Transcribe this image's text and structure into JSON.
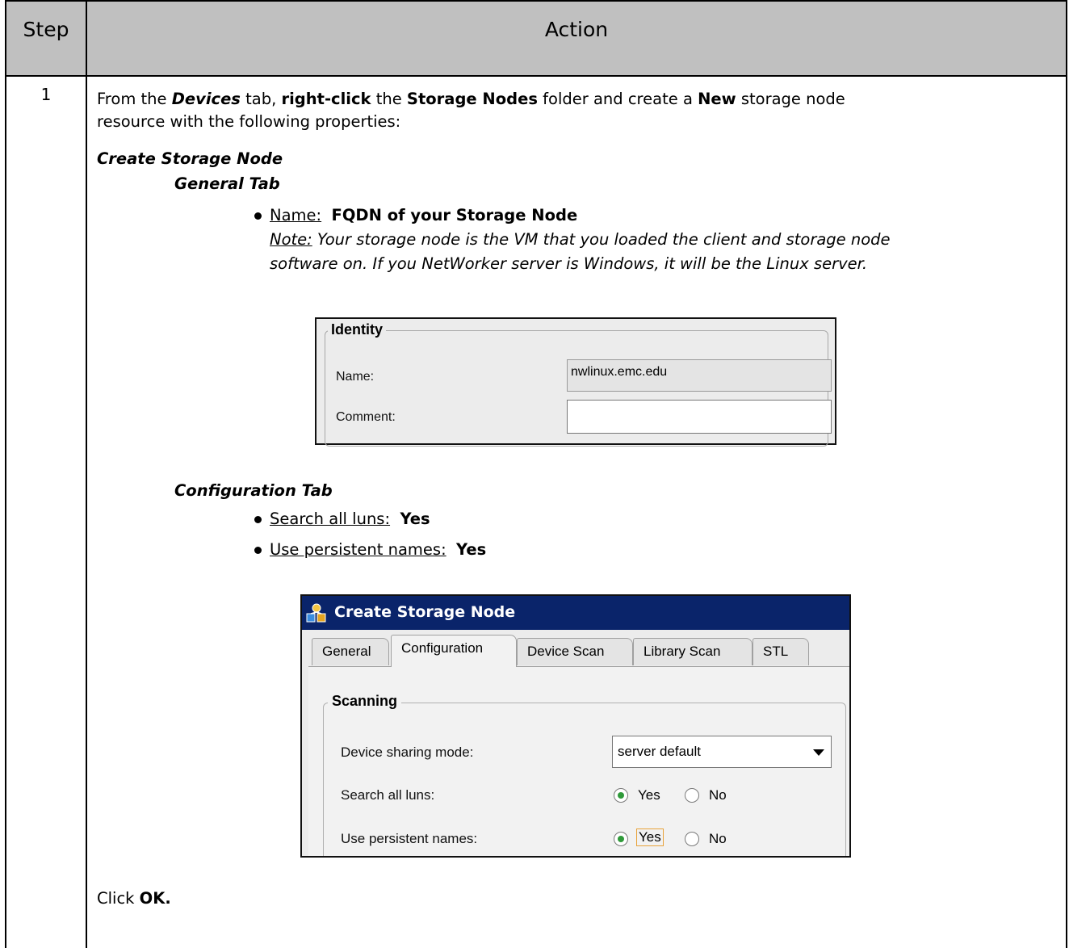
{
  "table": {
    "header_step": "Step",
    "header_action": "Action",
    "step_number": "1"
  },
  "intro": {
    "line1_a": "From the ",
    "devices": "Devices",
    "line1_b": " tab, ",
    "right_click": "right-click",
    "line1_c": " the ",
    "storage_nodes": "Storage Nodes",
    "line1_d": " folder and create a ",
    "new": "New",
    "line1_e": " storage node",
    "line2": "resource with the following properties:"
  },
  "create_heading": "Create Storage Node",
  "general_tab": {
    "heading": "General Tab",
    "name_label": "Name:",
    "name_value": "FQDN of your Storage Node",
    "note_label": "Note:",
    "note_line1": "  Your storage node is the VM that you loaded the client and storage node",
    "note_line2": "software on.  If you NetWorker server is Windows, it will be the Linux server."
  },
  "identity_panel": {
    "group_title": "Identity",
    "name_label": "Name:",
    "name_value": "nwlinux.emc.edu",
    "comment_label": "Comment:",
    "comment_value": ""
  },
  "configuration_tab": {
    "heading": "Configuration Tab",
    "item1_label": "Search all luns:",
    "item1_value": "Yes",
    "item2_label": "Use persistent names:",
    "item2_value": "Yes"
  },
  "dialog": {
    "title": "Create Storage Node",
    "tabs": [
      "General",
      "Configuration",
      "Device Scan",
      "Library Scan",
      "STL"
    ],
    "active_tab": "Configuration",
    "group_title": "Scanning",
    "sharing_label": "Device sharing mode:",
    "sharing_value": "server default",
    "luns_label": "Search all luns:",
    "persistent_label": "Use persistent names:",
    "yes": "Yes",
    "no": "No",
    "luns_selected": "Yes",
    "persistent_selected": "Yes",
    "accent_color": "#0a246a",
    "radio_color": "#2f9a3a"
  },
  "footer": {
    "click": "Click ",
    "ok": "OK."
  }
}
